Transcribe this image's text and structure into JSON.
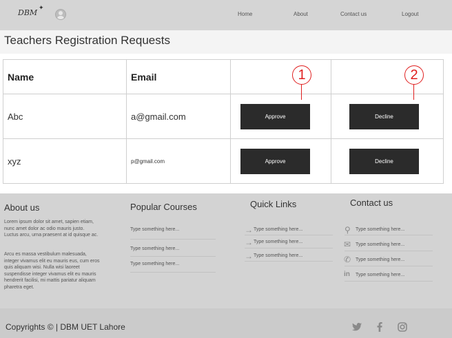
{
  "header": {
    "logo": "DBM",
    "nav": {
      "home": "Home",
      "about": "About",
      "contact": "Contact us",
      "logout": "Logout"
    }
  },
  "page_title": "Teachers  Registration Requests",
  "table": {
    "headers": {
      "name": "Name",
      "email": "Email"
    },
    "rows": [
      {
        "name": "Abc",
        "email": "a@gmail.com",
        "approve": "Approve",
        "decline": "Decline"
      },
      {
        "name": "xyz",
        "email": "p@gmail.com",
        "approve": "Approve",
        "decline": "Decline"
      }
    ],
    "annotations": {
      "one": "1",
      "two": "2"
    }
  },
  "footer": {
    "about": {
      "heading": "About us",
      "para1_lines": [
        "Lorem ipsum dolor sit amet, sapien etiam,",
        "nunc amet dolor ac odio mauris justo.",
        "Luctus arcu, urna praesent at id quisque ac."
      ],
      "para2_lines": [
        "Arcu es massa vestibulum malesuada,",
        "integer vivamus elit eu mauris eus, cum eros",
        "quis aliquam wisi. Nulla wisi laoreet",
        "suspendisse integer vivamus elit eu mauris",
        "hendrerit facilisi, mi mattis pariatur aliquam",
        "pharetra eget."
      ]
    },
    "courses": {
      "heading": "Popular Courses",
      "items": [
        "Type something here...",
        "Type something here...",
        "Type something here..."
      ]
    },
    "quick": {
      "heading": "Quick Links",
      "items": [
        "Type something here...",
        "Type something here...",
        "Type something here..."
      ]
    },
    "contact": {
      "heading": "Contact us",
      "items": [
        "Type something here...",
        "Type something here...",
        "Type something here...",
        "Type something here..."
      ]
    }
  },
  "bottom": {
    "copyright": "Copyrights © | DBM UET Lahore"
  }
}
